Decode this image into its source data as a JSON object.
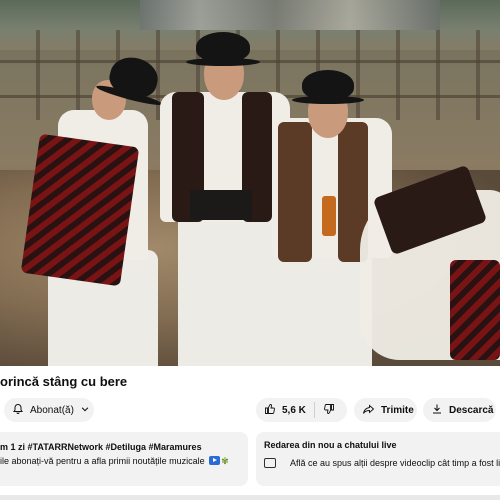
{
  "video": {
    "title": "orincă stâng cu bere"
  },
  "actions": {
    "subscribe_label": "Abonat(ă)",
    "like_count": "5,6 K",
    "share_label": "Trimite",
    "download_label": "Descarcă"
  },
  "description": {
    "date": "m 1 zi",
    "hashtags": "#TATARRNetwork #Detiluga #Maramures",
    "text": "ile abonați-vă pentru a afla primii noutățile muzicale"
  },
  "chat_replay": {
    "title": "Redarea din nou a chatului live",
    "text": "Află ce au spus alții despre videoclip cât timp a fost live"
  },
  "icons": {
    "bell": "bell-icon",
    "chevron": "chevron-down-icon",
    "like": "thumbs-up-icon",
    "dislike": "thumbs-down-icon",
    "share": "share-arrow-icon",
    "download": "download-icon",
    "chat": "chat-bubble-icon"
  }
}
